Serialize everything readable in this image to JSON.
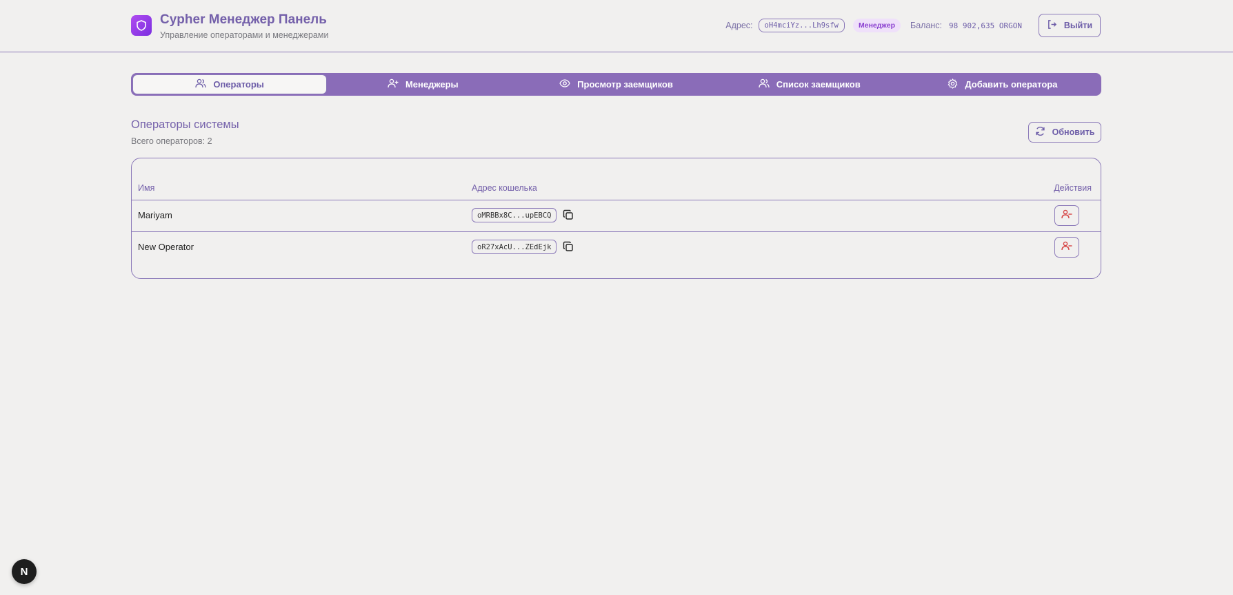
{
  "header": {
    "title": "Cypher Менеджер Панель",
    "subtitle": "Управление операторами и менеджерами",
    "address_label": "Адрес:",
    "address_value": "oH4mciYz...Lh9sfw",
    "role": "Менеджер",
    "balance_label": "Баланс:",
    "balance_value": "98 902,635 ORGON",
    "logout_label": "Выйти"
  },
  "tabs": [
    {
      "label": "Операторы",
      "icon": "users-icon",
      "active": true
    },
    {
      "label": "Менеджеры",
      "icon": "user-plus-icon",
      "active": false
    },
    {
      "label": "Просмотр заемщиков",
      "icon": "eye-icon",
      "active": false
    },
    {
      "label": "Список заемщиков",
      "icon": "users-icon",
      "active": false
    },
    {
      "label": "Добавить оператора",
      "icon": "gear-icon",
      "active": false
    }
  ],
  "section": {
    "title": "Операторы системы",
    "subtitle": "Всего операторов: 2",
    "refresh_label": "Обновить"
  },
  "table": {
    "columns": [
      "Имя",
      "Адрес кошелька",
      "Действия"
    ],
    "rows": [
      {
        "name": "Mariyam",
        "wallet": "oMRBBx8C...upEBCQ"
      },
      {
        "name": "New Operator",
        "wallet": "oR27xAcU...ZEdEjk"
      }
    ]
  },
  "floating_badge": "N",
  "colors": {
    "accent": "#8a6cb8",
    "text_accent": "#7460aa",
    "danger": "#d64545",
    "background": "#f1f0ef"
  }
}
